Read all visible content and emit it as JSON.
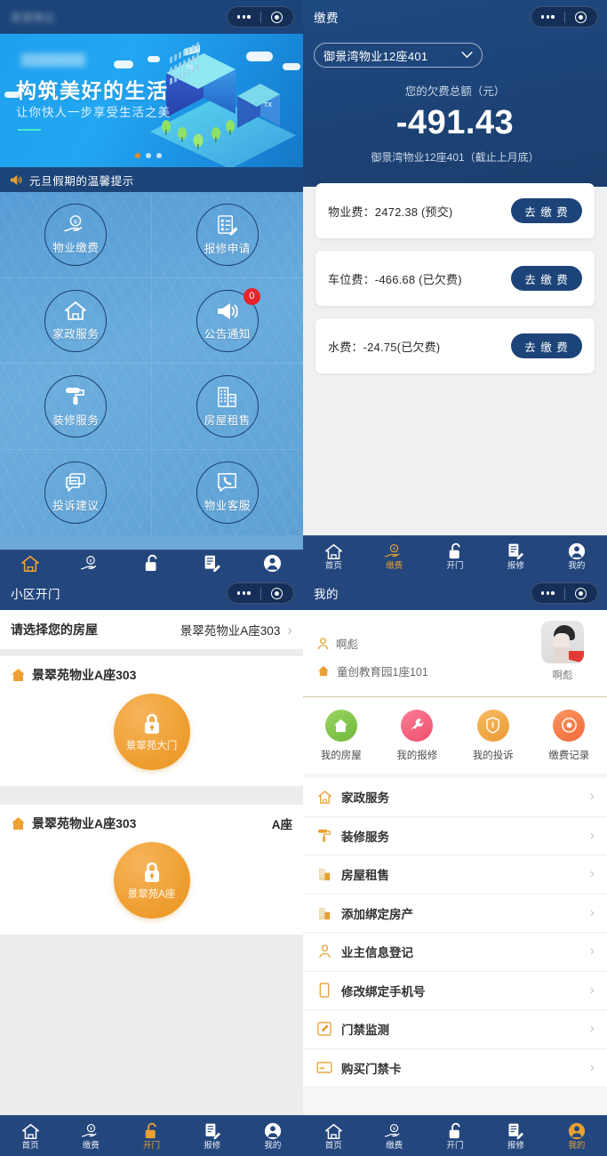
{
  "panels": {
    "home": {
      "nav_title": "某某物业",
      "nav_title_blurred": true,
      "banner": {
        "title": "构筑美好的生活",
        "subtitle": "让你快人一步享受生活之美",
        "brand_blurred": "某某物业",
        "dots_total": 3,
        "dots_active_index": 0
      },
      "notice": {
        "icon": "megaphone-icon",
        "text": "元旦假期的温馨提示"
      },
      "menu": [
        {
          "label": "物业缴费",
          "icon": "hand-coin-icon",
          "badge": null
        },
        {
          "label": "报修申请",
          "icon": "repair-form-icon",
          "badge": null
        },
        {
          "label": "家政服务",
          "icon": "house-icon",
          "badge": null
        },
        {
          "label": "公告通知",
          "icon": "megaphone-icon",
          "badge": "0"
        },
        {
          "label": "装修服务",
          "icon": "paint-roller-icon",
          "badge": null
        },
        {
          "label": "房屋租售",
          "icon": "buildings-icon",
          "badge": null
        },
        {
          "label": "投诉建议",
          "icon": "chat-bubbles-icon",
          "badge": null
        },
        {
          "label": "物业客服",
          "icon": "phone-chat-icon",
          "badge": null
        }
      ]
    },
    "payment": {
      "nav_title": "缴费",
      "selector_value": "御景湾物业12座401",
      "total_label": "您的欠费总额（元）",
      "total_amount": "-491.43",
      "note": "御景湾物业12座401（截止上月底）",
      "bills": [
        {
          "text": "物业费：2472.38 (预交)",
          "button": "去 缴 费"
        },
        {
          "text": "车位费：-466.68 (已欠费)",
          "button": "去 缴 费"
        },
        {
          "text": "水费：-24.75(已欠费)",
          "button": "去 缴 费"
        }
      ]
    },
    "opendoor": {
      "nav_title": "小区开门",
      "picker_label": "请选择您的房屋",
      "picker_value": "景翠苑物业A座303",
      "doors": [
        {
          "house": "景翠苑物业A座303",
          "side": "",
          "button_label": "景翠苑大门"
        },
        {
          "house": "景翠苑物业A座303",
          "side": "A座",
          "button_label": "景翠苑A座"
        }
      ]
    },
    "mine": {
      "nav_title": "我的",
      "user_name": "啊彪",
      "user_address": "童创教育园1座101",
      "avatar_name": "啊彪",
      "quick": [
        {
          "label": "我的房屋",
          "icon": "house-icon",
          "color": "#7cc04a"
        },
        {
          "label": "我的报修",
          "icon": "wrench-icon",
          "color": "#f4637a"
        },
        {
          "label": "我的投诉",
          "icon": "shield-icon",
          "color": "#f0a84a"
        },
        {
          "label": "缴费记录",
          "icon": "record-eye-icon",
          "color": "#f57f49"
        }
      ],
      "list": [
        {
          "label": "家政服务",
          "icon": "house-outline-icon"
        },
        {
          "label": "装修服务",
          "icon": "paint-roller-icon"
        },
        {
          "label": "房屋租售",
          "icon": "buildings-icon"
        },
        {
          "label": "添加绑定房产",
          "icon": "buildings-icon"
        },
        {
          "label": "业主信息登记",
          "icon": "person-icon"
        },
        {
          "label": "修改绑定手机号",
          "icon": "phone-icon"
        },
        {
          "label": "门禁监测",
          "icon": "edit-square-icon"
        },
        {
          "label": "购买门禁卡",
          "icon": "card-icon"
        }
      ]
    }
  },
  "tabbar": {
    "items": [
      {
        "label": "首页",
        "icon": "home-icon"
      },
      {
        "label": "缴费",
        "icon": "hand-coin-icon"
      },
      {
        "label": "开门",
        "icon": "unlock-icon"
      },
      {
        "label": "报修",
        "icon": "repair-form-icon"
      },
      {
        "label": "我的",
        "icon": "person-icon"
      }
    ],
    "active": {
      "home": "首页",
      "payment": "缴费",
      "opendoor": "开门",
      "mine": "我的"
    }
  },
  "capsule": {
    "more_icon": "more-dots-icon",
    "target_icon": "target-circle-icon"
  },
  "colors": {
    "nav_blue": "#1d4478",
    "tab_blue": "#23467d",
    "accent_orange": "#e8a033",
    "banner_blue": "#1ea0ee",
    "badge_red": "#e8252a",
    "lock_orange": "#efa033"
  }
}
